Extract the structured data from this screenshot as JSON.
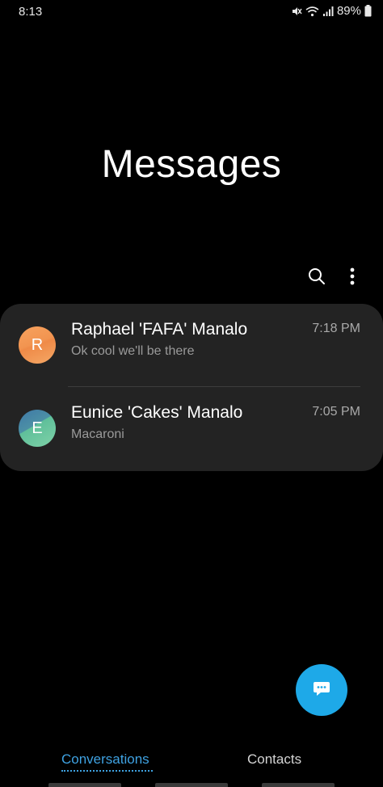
{
  "status_bar": {
    "time": "8:13",
    "battery": "89%",
    "icons": [
      "mute-icon",
      "wifi-icon",
      "signal-icon",
      "battery-icon"
    ]
  },
  "header": {
    "title": "Messages"
  },
  "actions": {
    "search_icon": "search-icon",
    "more_icon": "more-options-icon"
  },
  "conversations": [
    {
      "initial": "R",
      "name": "Raphael 'FAFA' Manalo",
      "preview": "Ok cool we'll be there",
      "time": "7:18 PM",
      "avatar_colors": [
        "#f7a25e",
        "#ef8a47"
      ]
    },
    {
      "initial": "E",
      "name": "Eunice 'Cakes' Manalo",
      "preview": "Macaroni",
      "time": "7:05 PM",
      "avatar_colors": [
        "#3f78a8",
        "#7fd2a8"
      ]
    }
  ],
  "fab": {
    "icon": "compose-message-icon",
    "color": "#1ea9e8"
  },
  "tabs": [
    {
      "label": "Conversations",
      "active": true
    },
    {
      "label": "Contacts",
      "active": false
    }
  ],
  "colors": {
    "background": "#000000",
    "card": "#232323",
    "accent": "#3fa2e2"
  }
}
